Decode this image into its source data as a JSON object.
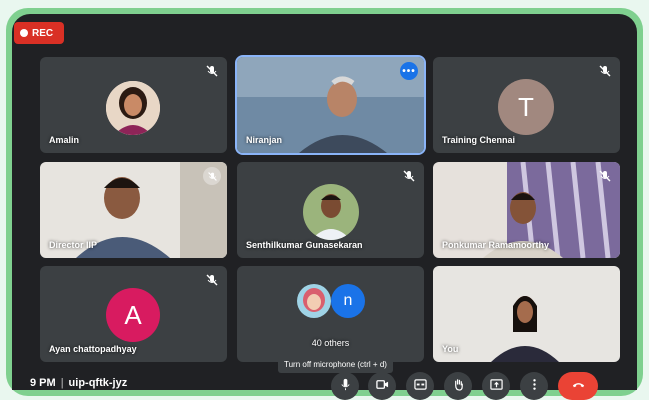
{
  "recording": {
    "label": "REC"
  },
  "participants": [
    {
      "name": "Amalin"
    },
    {
      "name": "Niranjan"
    },
    {
      "name": "Training Chennai",
      "initial": "T"
    },
    {
      "name": "Director IIP"
    },
    {
      "name": "Senthilkumar Gunasekaran"
    },
    {
      "name": "Ponkumar Ramamoorthy"
    },
    {
      "name": "Ayan chattopadhyay",
      "initial": "A"
    },
    {
      "name": "40 others",
      "initial": "n"
    },
    {
      "name": "You"
    }
  ],
  "tooltip": "Turn off microphone (ctrl + d)",
  "footer": {
    "time": "9 PM",
    "meeting_code": "uip-qftk-jyz"
  },
  "colors": {
    "accent": "#1a73e8",
    "end_call": "#ea4335",
    "frame": "#7fd08f",
    "tile": "#3c4043",
    "avatar_T": "#a1887f",
    "avatar_A": "#d81b60"
  }
}
